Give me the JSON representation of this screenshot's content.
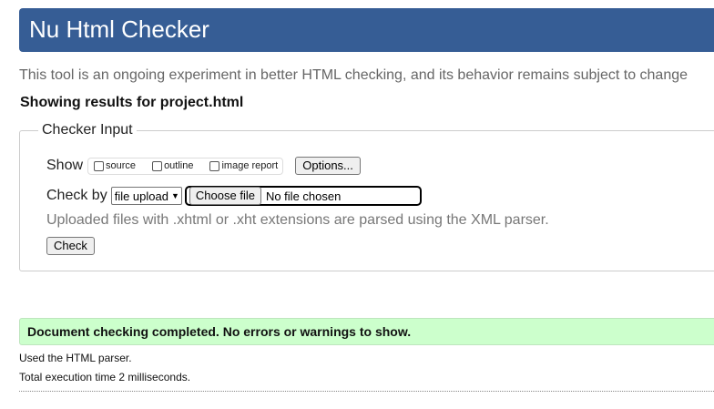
{
  "header": {
    "title": "Nu Html Checker"
  },
  "intro": "This tool is an ongoing experiment in better HTML checking, and its behavior remains subject to change",
  "results_for": "Showing results for project.html",
  "checker_input": {
    "legend": "Checker Input",
    "show_label": "Show",
    "show_options": [
      {
        "label": "source",
        "checked": false
      },
      {
        "label": "outline",
        "checked": false
      },
      {
        "label": "image report",
        "checked": false
      }
    ],
    "options_button": "Options...",
    "check_by_label": "Check by",
    "check_by_selected": "file upload",
    "choose_file_button": "Choose file",
    "no_file_text": "No file chosen",
    "parser_note": "Uploaded files with .xhtml or .xht extensions are parsed using the XML parser.",
    "check_button": "Check"
  },
  "result": {
    "success_message": "Document checking completed. No errors or warnings to show.",
    "parser_used": "Used the HTML parser.",
    "execution_time": "Total execution time 2 milliseconds."
  }
}
